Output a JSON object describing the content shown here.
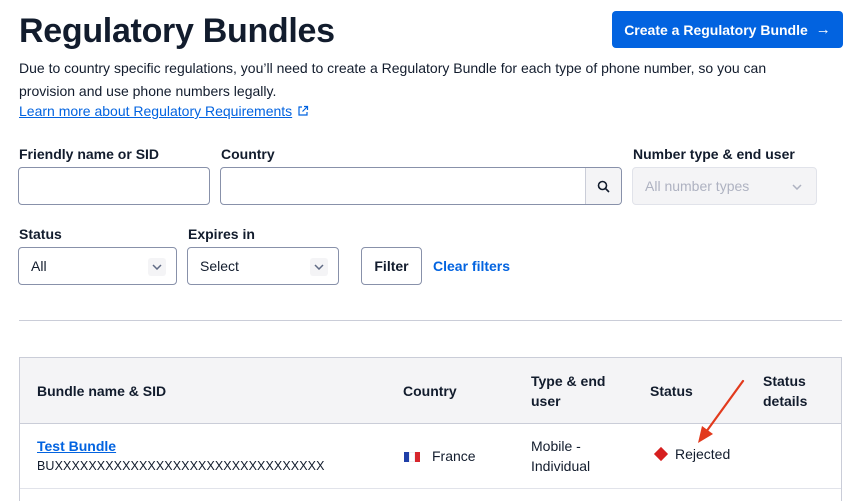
{
  "header": {
    "title": "Regulatory Bundles",
    "create_button_label": "Create a Regulatory Bundle",
    "create_button_arrow": "→"
  },
  "intro": {
    "text": "Due to country specific regulations, you’ll need to create a Regulatory Bundle for each type of phone number, so you can provision and use phone numbers legally.",
    "learn_more_label": "Learn more about Regulatory Requirements"
  },
  "filters": {
    "friendly_name": {
      "label": "Friendly name or SID",
      "value": ""
    },
    "country": {
      "label": "Country",
      "value": ""
    },
    "number_type": {
      "label": "Number type & end user",
      "selected": "All number types"
    },
    "status": {
      "label": "Status",
      "selected": "All"
    },
    "expires": {
      "label": "Expires in",
      "selected": "Select"
    },
    "filter_button": "Filter",
    "clear_filters": "Clear filters"
  },
  "table": {
    "headers": {
      "bundle": "Bundle name & SID",
      "country": "Country",
      "type_line1": "Type & end",
      "type_line2": "user",
      "status": "Status",
      "details_line1": "Status",
      "details_line2": "details"
    },
    "rows": [
      {
        "name": "Test Bundle",
        "sid": "BUXXXXXXXXXXXXXXXXXXXXXXXXXXXXXXXX",
        "country": "France",
        "type_line1": "Mobile -",
        "type_line2": "Individual",
        "status": "Rejected",
        "status_details": ""
      }
    ]
  },
  "colors": {
    "brand_blue": "#0263e0",
    "status_rejected": "#d61f1f",
    "annotation_arrow": "#e23a1d"
  },
  "icons": {
    "create_arrow": "arrow-right-icon",
    "external_link": "external-link-icon",
    "search": "search-icon",
    "chevron": "chevron-down-icon",
    "flag": "france-flag-icon",
    "status": "error-diamond-icon"
  }
}
